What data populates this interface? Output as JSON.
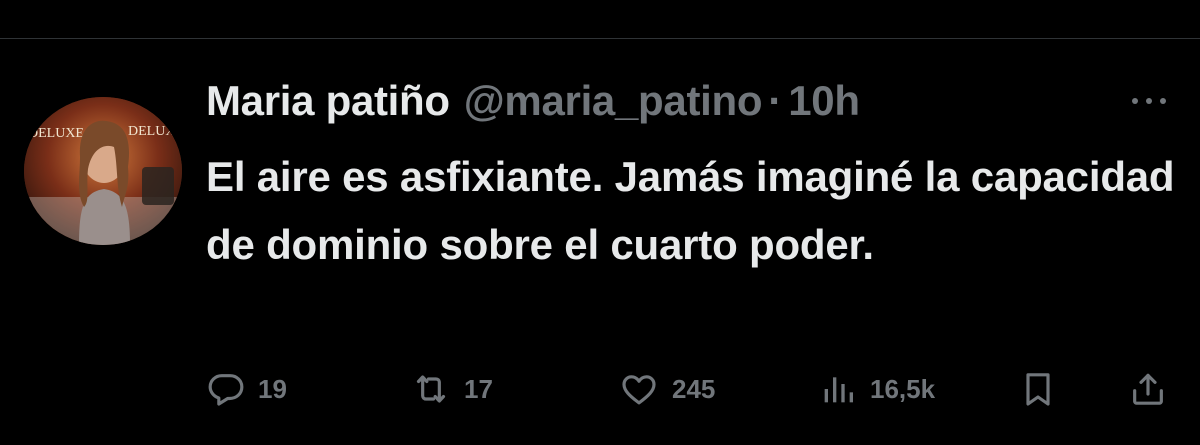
{
  "tweet": {
    "display_name": "Maria patiño",
    "handle": "@maria_patino",
    "separator": "·",
    "time": "10h",
    "text": "El aire es asfixiante. Jamás imaginé la capacidad de dominio sobre el cuarto poder.",
    "avatar_text": [
      "DELUXE",
      "DELUXE"
    ],
    "icons": {
      "more": "more-dots-icon",
      "reply": "reply-icon",
      "retweet": "retweet-icon",
      "like": "heart-icon",
      "views": "views-icon",
      "bookmark": "bookmark-icon",
      "share": "share-icon"
    },
    "stats": {
      "replies": "19",
      "retweets": "17",
      "likes": "245",
      "views": "16,5k"
    }
  },
  "colors": {
    "background": "#000000",
    "text": "#e7e9ea",
    "secondary": "#71767b",
    "divider": "#2f3336"
  }
}
